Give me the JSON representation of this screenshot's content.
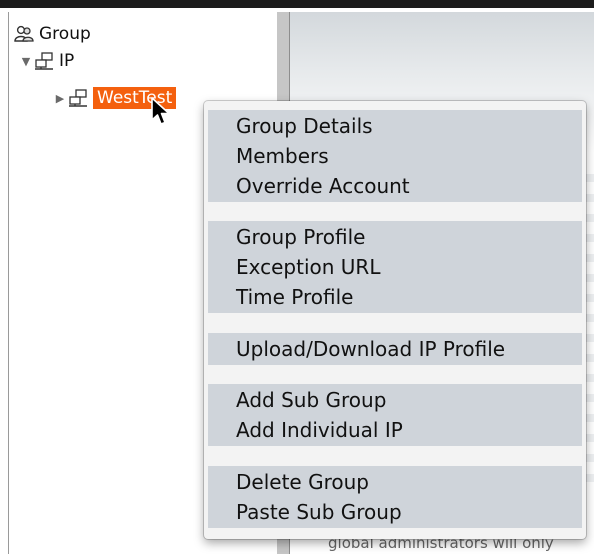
{
  "tree": {
    "root": {
      "label": "Group",
      "icon": "group-users-icon"
    },
    "ip_node": {
      "label": "IP",
      "icon": "network-icon",
      "expanded": true
    },
    "selected_node": {
      "label": "WestTest",
      "icon": "network-icon",
      "expanded": false
    }
  },
  "context_menu": {
    "groups": [
      [
        "Group Details",
        "Members",
        "Override Account"
      ],
      [
        "Group Profile",
        "Exception URL",
        "Time Profile"
      ],
      [
        "Upload/Download IP Profile"
      ],
      [
        "Add Sub Group",
        "Add Individual IP"
      ],
      [
        "Delete Group",
        "Paste Sub Group"
      ]
    ]
  },
  "background": {
    "footer_text": "global administrators will only"
  },
  "colors": {
    "selection": "#f4600e",
    "menu_band": "#cfd4da",
    "menu_bg": "#f3f3f3"
  }
}
